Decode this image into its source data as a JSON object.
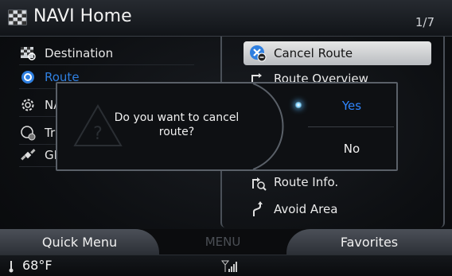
{
  "header": {
    "title": "NAVI Home",
    "page": "1/7"
  },
  "left_menu": [
    {
      "label": "Destination",
      "icon": "destination-flag-icon"
    },
    {
      "label": "Route",
      "icon": "route-icon",
      "active": true
    },
    {
      "label": "NA",
      "icon": "settings-gear-icon"
    },
    {
      "label": "Tr",
      "icon": "traffic-icon"
    },
    {
      "label": "GI",
      "icon": "gps-satellite-icon"
    }
  ],
  "right_menu": [
    {
      "label": "Cancel Route",
      "icon": "cancel-route-icon",
      "highlight": true
    },
    {
      "label": "Route Overview",
      "icon": "route-overview-icon"
    },
    {
      "label": "Route Info.",
      "icon": "route-info-icon"
    },
    {
      "label": "Avoid Area",
      "icon": "avoid-area-icon"
    }
  ],
  "dialog": {
    "message": "Do you want to cancel route?",
    "yes": "Yes",
    "no": "No",
    "icon": "warning-question-icon"
  },
  "bottom_bar": {
    "quick_menu": "Quick Menu",
    "menu": "MENU",
    "favorites": "Favorites"
  },
  "status": {
    "temperature": "68°F"
  },
  "colors": {
    "accent": "#2f86ff",
    "active_text": "#2f7fe0",
    "highlight_bg": "#d6d8db"
  }
}
